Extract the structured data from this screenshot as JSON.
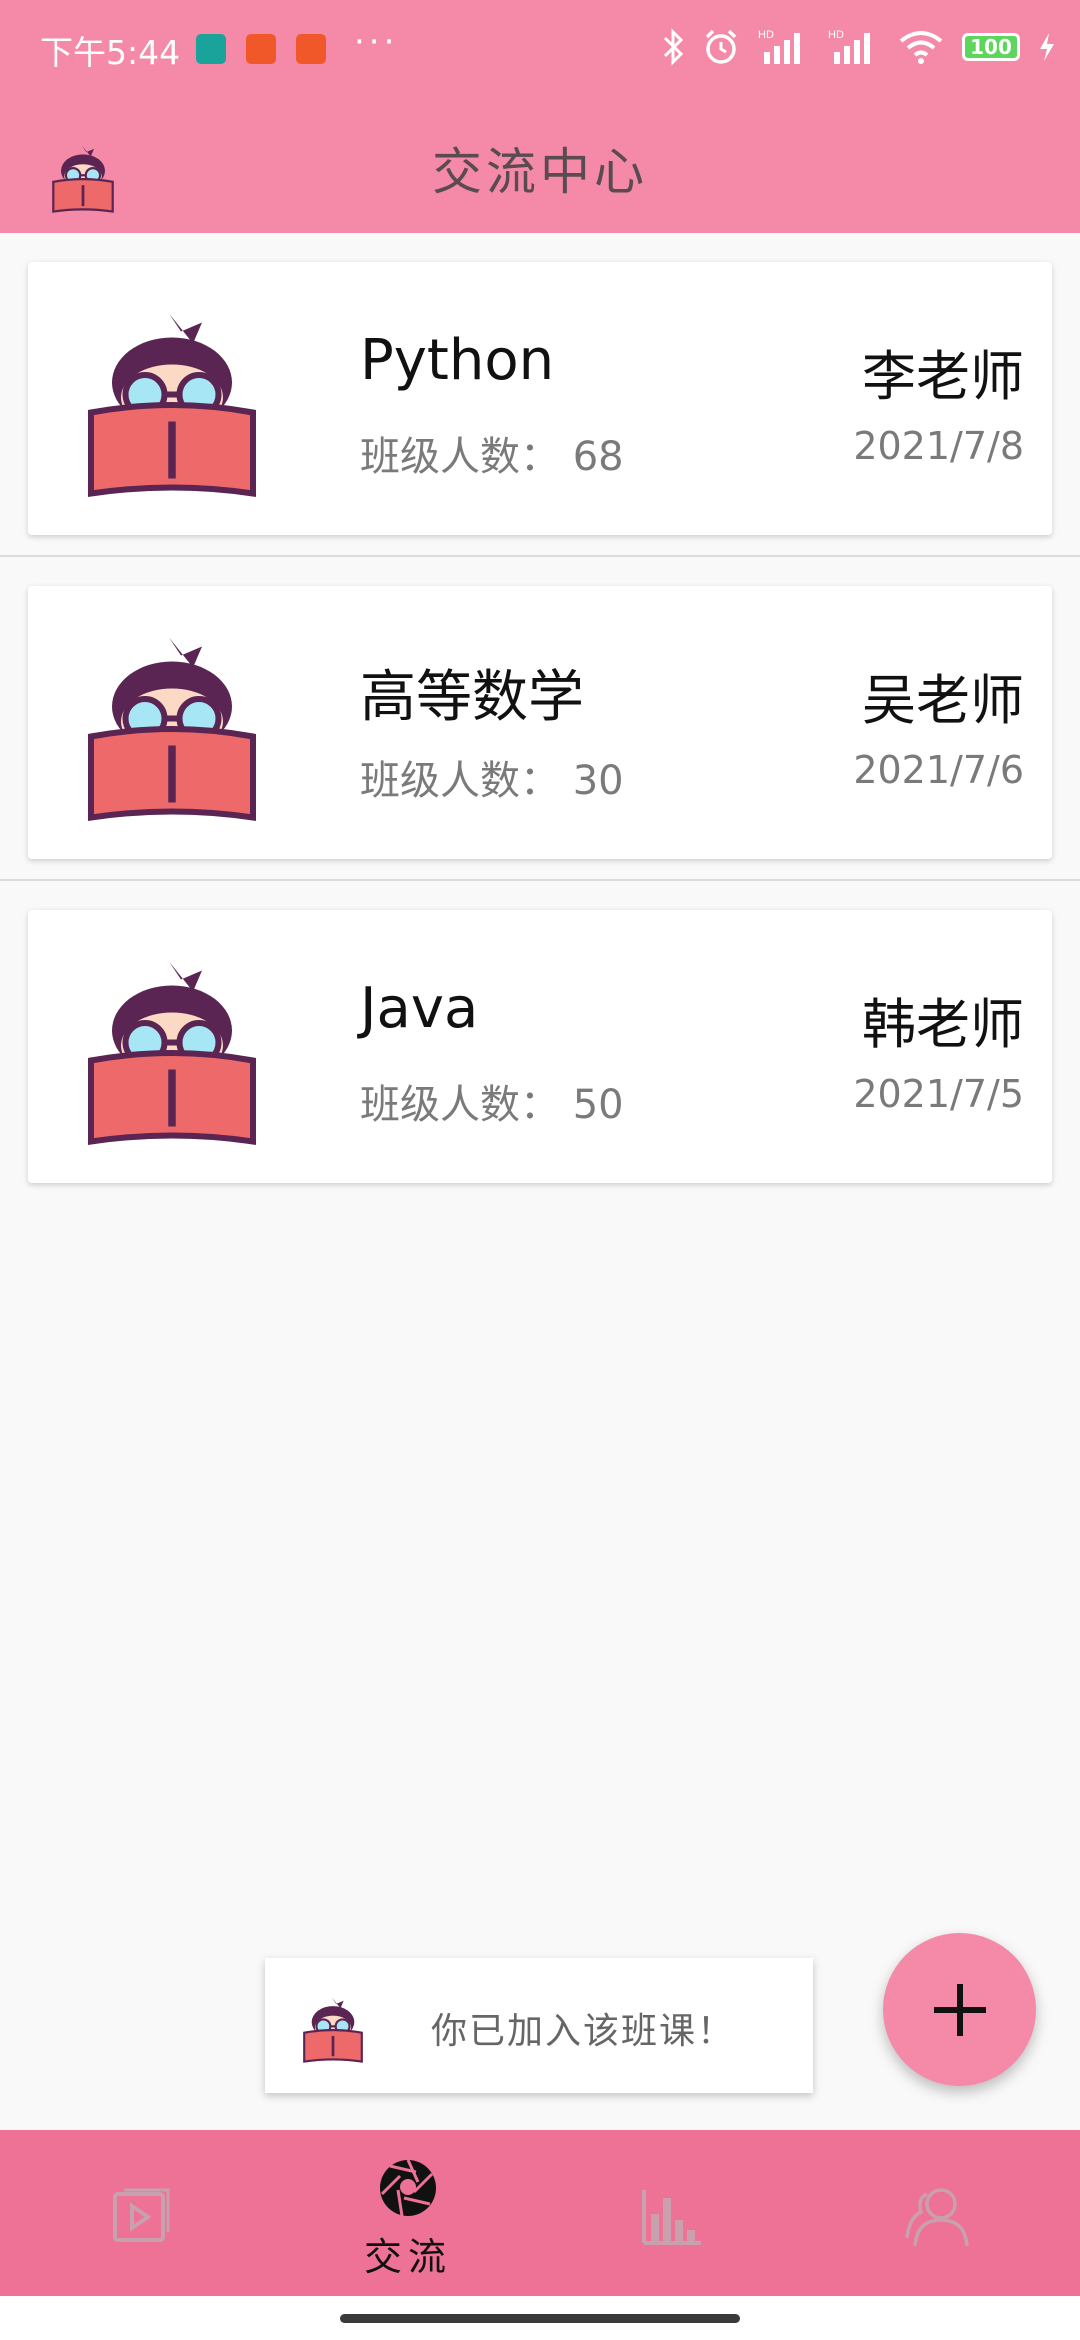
{
  "status_bar": {
    "time": "下午5:44",
    "battery": "100",
    "icons": [
      "app-notification-icon",
      "wechat-icon",
      "wechat-icon",
      "more-dots-icon",
      "bluetooth-icon",
      "alarm-icon",
      "signal-hd-icon",
      "signal-hd-icon",
      "wifi-icon",
      "battery-icon",
      "charging-icon"
    ]
  },
  "app_bar": {
    "title": "交流中心",
    "logo": "reading-student-logo"
  },
  "classes": [
    {
      "name": "Python",
      "count_label": "班级人数：",
      "count": "68",
      "teacher": "李老师",
      "date": "2021/7/8"
    },
    {
      "name": "高等数学",
      "count_label": "班级人数：",
      "count": "30",
      "teacher": "吴老师",
      "date": "2021/7/6"
    },
    {
      "name": "Java",
      "count_label": "班级人数：",
      "count": "50",
      "teacher": "韩老师",
      "date": "2021/7/5"
    }
  ],
  "toast": {
    "message": "你已加入该班课！"
  },
  "fab": {
    "icon": "plus-icon"
  },
  "bottom_nav": {
    "items": [
      {
        "icon": "video-icon",
        "label": ""
      },
      {
        "icon": "aperture-icon",
        "label": "交流",
        "active": true
      },
      {
        "icon": "bar-chart-icon",
        "label": ""
      },
      {
        "icon": "people-icon",
        "label": ""
      }
    ]
  },
  "colors": {
    "primary": "#f48aa7",
    "bottom_nav": "#ee7196",
    "background": "#f9f9f9",
    "book": "#ee6969",
    "hair": "#5a2552"
  }
}
